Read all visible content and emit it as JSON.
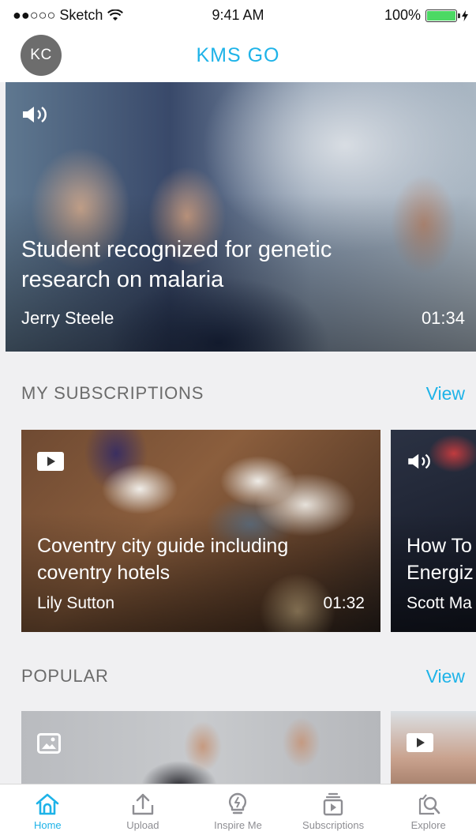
{
  "status_bar": {
    "carrier": "●●○○○ Sketch",
    "time": "9:41 AM",
    "battery": "100%"
  },
  "header": {
    "avatar_initials": "KC",
    "app_title": "KMS GO"
  },
  "hero": {
    "type_icon": "sound-icon",
    "title": "Student recognized for genetic research on malaria",
    "author": "Jerry Steele",
    "duration": "01:34"
  },
  "subscriptions": {
    "title": "MY SUBSCRIPTIONS",
    "view_label": "View",
    "cards": [
      {
        "type_icon": "video-icon",
        "title_line1": "Coventry city guide including",
        "title_line2": "coventry hotels",
        "author": "Lily Sutton",
        "duration": "01:32"
      },
      {
        "type_icon": "sound-icon",
        "title_line1": "How To",
        "title_line2": "Energiz",
        "author": "Scott Ma"
      }
    ]
  },
  "popular": {
    "title": "POPULAR",
    "view_label": "View",
    "cards": [
      {
        "type_icon": "image-icon"
      },
      {
        "type_icon": "video-icon"
      }
    ]
  },
  "tabbar": {
    "active": "Home",
    "tabs": [
      {
        "label": "Home",
        "icon": "home-icon"
      },
      {
        "label": "Upload",
        "icon": "upload-icon"
      },
      {
        "label": "Inspire Me",
        "icon": "lightbulb-icon"
      },
      {
        "label": "Subscriptions",
        "icon": "subscriptions-icon"
      },
      {
        "label": "Explore",
        "icon": "explore-icon"
      }
    ]
  },
  "colors": {
    "accent": "#1eb3e8",
    "section_title": "#6b6b6b",
    "tab_inactive": "#8e8e93",
    "battery": "#4cd964"
  }
}
